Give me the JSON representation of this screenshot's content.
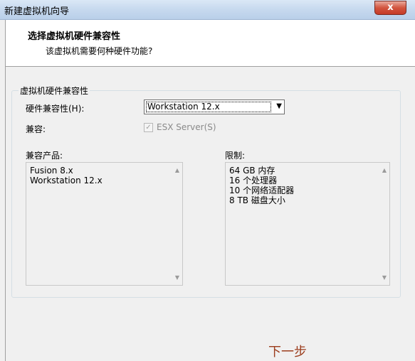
{
  "window": {
    "title": "新建虚拟机向导",
    "close_glyph": "x"
  },
  "header": {
    "title": "选择虚拟机硬件兼容性",
    "subtitle": "该虚拟机需要何种硬件功能?"
  },
  "group": {
    "legend": "虚拟机硬件兼容性",
    "hardware_label": "硬件兼容性(H):",
    "hardware_value": "Workstation 12.x",
    "compatible_label": "兼容:",
    "esx_label": "ESX Server(S)",
    "esx_checked": true,
    "products_label": "兼容产品:",
    "products": [
      "Fusion 8.x",
      "Workstation 12.x"
    ],
    "limits_label": "限制:",
    "limits": [
      "64 GB 内存",
      "16 个处理器",
      "10 个网络适配器",
      "8 TB 磁盘大小"
    ]
  },
  "annotation": "下一步"
}
